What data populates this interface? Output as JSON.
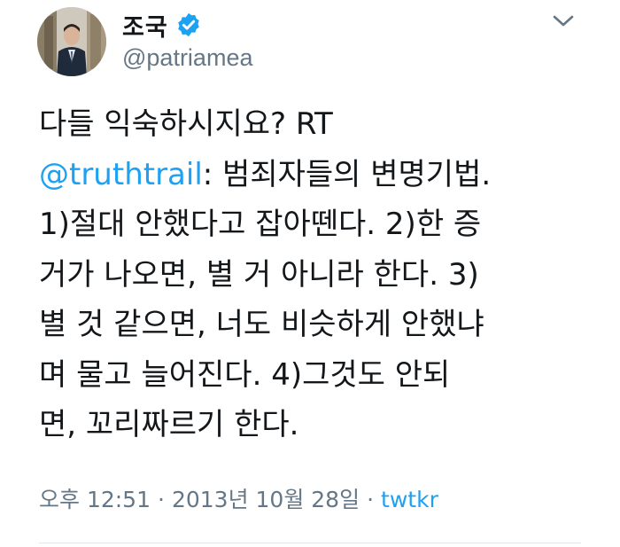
{
  "author": {
    "display_name": "조국",
    "handle": "@patriamea",
    "verified": true,
    "avatar": "person-in-suit-photo"
  },
  "menu": {
    "icon": "chevron-down-icon"
  },
  "tweet": {
    "lines": [
      {
        "text": "다들 익숙하시지요? RT"
      },
      {
        "mention": "@truthtrail",
        "text": ": 범죄자들의 변명기법."
      },
      {
        "text": "1)절대 안했다고 잡아뗀다. 2)한 증"
      },
      {
        "text": "거가 나오면, 별 거 아니라 한다. 3)"
      },
      {
        "text": "별 것 같으면, 너도 비슷하게 안했냐"
      },
      {
        "text": "며 물고 늘어진다. 4)그것도 안되"
      },
      {
        "text": "면, 꼬리짜르기 한다."
      }
    ]
  },
  "meta": {
    "time": "오후 12:51",
    "date": "2013년 10월 28일",
    "separator": "·",
    "source": "twtkr"
  },
  "colors": {
    "link": "#1da1f2",
    "secondary": "#657786",
    "text": "#14171a",
    "verified": "#1da1f2"
  }
}
